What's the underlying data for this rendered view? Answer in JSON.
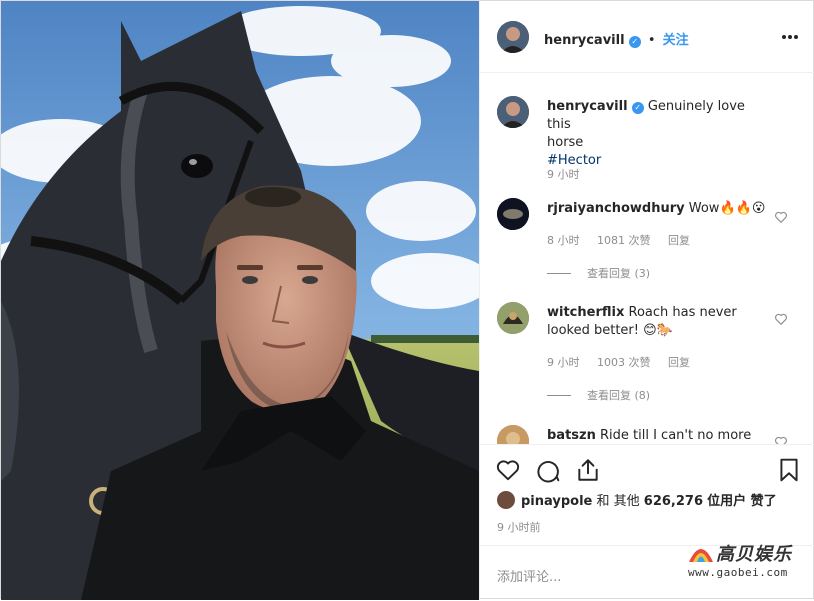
{
  "post": {
    "username": "henrycavill",
    "verified_mark": "✓",
    "separator": "•",
    "follow_label": "关注",
    "more_icon": "more-horizontal-icon"
  },
  "caption": {
    "username": "henrycavill",
    "text_line1": "Genuinely love this",
    "text_line2": "horse",
    "hashtag": "#Hector",
    "time": "9 小时"
  },
  "comments": [
    {
      "username": "rjraiyanchowdhury",
      "text": "Wow",
      "emoji": "🔥🔥😮",
      "time": "8 小时",
      "likes": "1081 次赞",
      "reply_label": "回复",
      "view_replies": "查看回复 (3)"
    },
    {
      "username": "witcherflix",
      "text": "Roach has never",
      "text2": "looked better!",
      "emoji": "😊🐎",
      "time": "9 小时",
      "likes": "1003 次赞",
      "reply_label": "回复",
      "view_replies": "查看回复 (8)"
    },
    {
      "username": "batszn",
      "text": "Ride till I can't no more"
    }
  ],
  "likes_line": {
    "user": "pinaypole",
    "middle": "和 其他",
    "count": "626,276",
    "suffix": "位用户 赞了"
  },
  "time_ago": "9 小时前",
  "add_comment_placeholder": "添加评论...",
  "watermark": {
    "brand": "高贝娱乐",
    "site": "www.gaobei.com"
  },
  "colors": {
    "accent_blue": "#3897f0",
    "link_navy": "#003569",
    "muted_grey": "#8e8e8e",
    "border": "#efefef"
  }
}
